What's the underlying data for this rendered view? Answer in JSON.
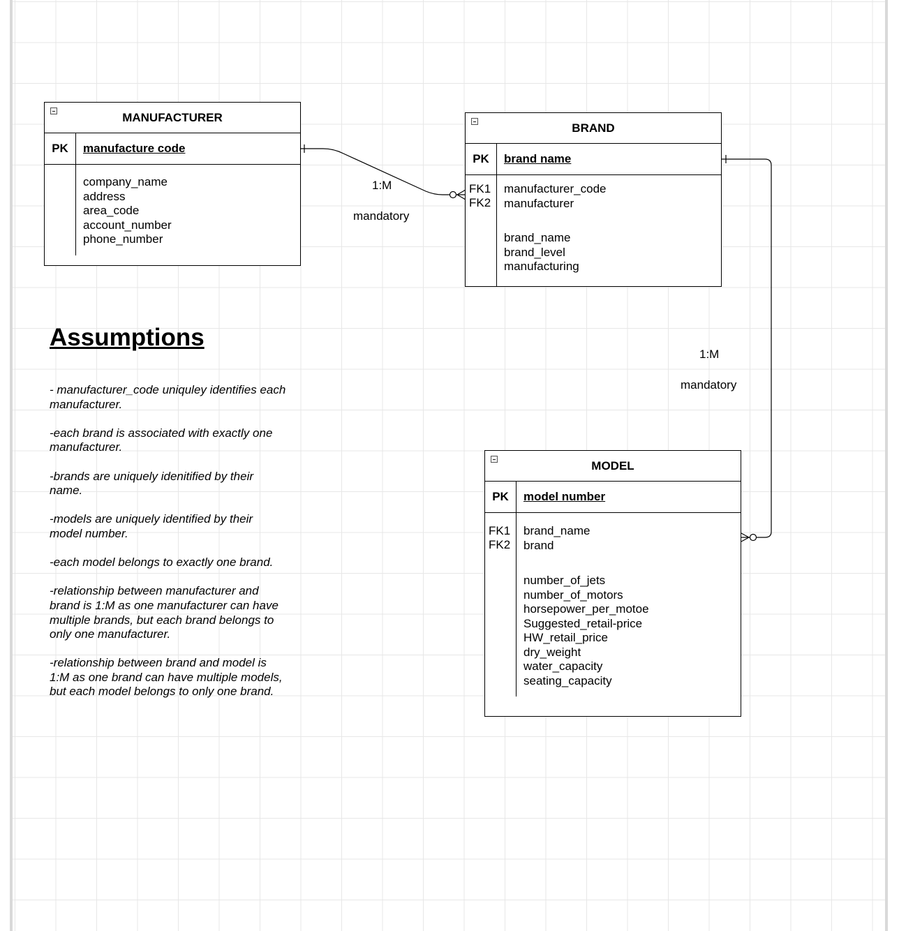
{
  "diagram": {
    "entities": {
      "manufacturer": {
        "title": "MANUFACTURER",
        "pk_label": "PK",
        "pk_name": "manufacture code",
        "attributes": [
          "company_name",
          "address",
          "area_code",
          "account_number",
          "phone_number"
        ]
      },
      "brand": {
        "title": "BRAND",
        "pk_label": "PK",
        "pk_name": "brand name",
        "fk_labels": [
          "FK1",
          "FK2"
        ],
        "fk_attributes": [
          "manufacturer_code",
          "manufacturer"
        ],
        "attributes": [
          "brand_name",
          "brand_level",
          "manufacturing"
        ]
      },
      "model": {
        "title": "MODEL",
        "pk_label": "PK",
        "pk_name": "model number",
        "fk_labels": [
          "FK1",
          "FK2"
        ],
        "fk_attributes": [
          "brand_name",
          "brand"
        ],
        "attributes": [
          "number_of_jets",
          "number_of_motors",
          "horsepower_per_motoe",
          "Suggested_retail-price",
          "HW_retail_price",
          "dry_weight",
          "water_capacity",
          "seating_capacity"
        ]
      }
    },
    "relationships": [
      {
        "from": "manufacturer",
        "to": "brand",
        "cardinality": "1:M",
        "participation": "mandatory"
      },
      {
        "from": "brand",
        "to": "model",
        "cardinality": "1:M",
        "participation": "mandatory"
      }
    ]
  },
  "assumptions": {
    "heading": "Assumptions",
    "items": [
      "- manufacturer_code uniquley identifies each manufacturer.",
      "-each brand is associated with exactly one manufacturer.",
      "-brands are uniquely idenitified by their name.",
      "-models are uniquely identified by their model number.",
      "-each model belongs to exactly one brand.",
      "-relationship between manufacturer and brand is 1:M as one manufacturer can have multiple brands, but each brand belongs to only one manufacturer.",
      "-relationship between brand and model is 1:M as one brand can have multiple models, but each model belongs to only one brand."
    ]
  },
  "colors": {
    "line": "#000000",
    "grid": "#e7e7e7",
    "background": "#ffffff"
  }
}
